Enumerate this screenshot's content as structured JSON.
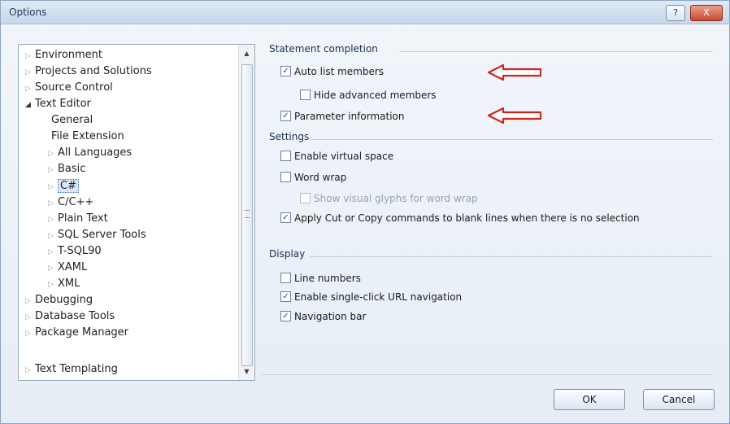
{
  "window": {
    "title": "Options",
    "help_label": "?",
    "close_label": "X"
  },
  "tree": {
    "items": [
      {
        "label": "Environment",
        "arrow": "▷"
      },
      {
        "label": "Projects and Solutions",
        "arrow": "▷"
      },
      {
        "label": "Source Control",
        "arrow": "▷"
      },
      {
        "label": "Text Editor",
        "arrow": "◢"
      },
      {
        "label": "General",
        "arrow": ""
      },
      {
        "label": "File Extension",
        "arrow": ""
      },
      {
        "label": "All Languages",
        "arrow": "▷"
      },
      {
        "label": "Basic",
        "arrow": "▷"
      },
      {
        "label": "C#",
        "arrow": "▷"
      },
      {
        "label": "C/C++",
        "arrow": "▷"
      },
      {
        "label": "Plain Text",
        "arrow": "▷"
      },
      {
        "label": "SQL Server Tools",
        "arrow": "▷"
      },
      {
        "label": "T-SQL90",
        "arrow": "▷"
      },
      {
        "label": "XAML",
        "arrow": "▷"
      },
      {
        "label": "XML",
        "arrow": "▷"
      },
      {
        "label": "Debugging",
        "arrow": "▷"
      },
      {
        "label": "Database Tools",
        "arrow": "▷"
      },
      {
        "label": "Package Manager",
        "arrow": "▷"
      },
      {
        "label": "Text Templating",
        "arrow": "▷"
      }
    ],
    "selected": "C#"
  },
  "statement_completion": {
    "title": "Statement completion",
    "auto_list_members": {
      "label": "Auto list members",
      "checked": true
    },
    "hide_advanced_members": {
      "label": "Hide advanced members",
      "checked": false
    },
    "parameter_information": {
      "label": "Parameter information",
      "checked": true
    }
  },
  "settings": {
    "title": "Settings",
    "enable_virtual_space": {
      "label": "Enable virtual space",
      "checked": false
    },
    "word_wrap": {
      "label": "Word wrap",
      "checked": false
    },
    "show_visual_glyphs": {
      "label": "Show visual glyphs for word wrap",
      "checked": false
    },
    "apply_cut_copy": {
      "label": "Apply Cut or Copy commands to blank lines when there is no selection",
      "checked": true
    }
  },
  "display": {
    "title": "Display",
    "line_numbers": {
      "label": "Line numbers",
      "checked": false
    },
    "single_click_url": {
      "label": "Enable single-click URL navigation",
      "checked": true
    },
    "navigation_bar": {
      "label": "Navigation bar",
      "checked": true
    }
  },
  "buttons": {
    "ok": "OK",
    "cancel": "Cancel"
  },
  "colors": {
    "annotation_arrow": "#d0241d"
  }
}
